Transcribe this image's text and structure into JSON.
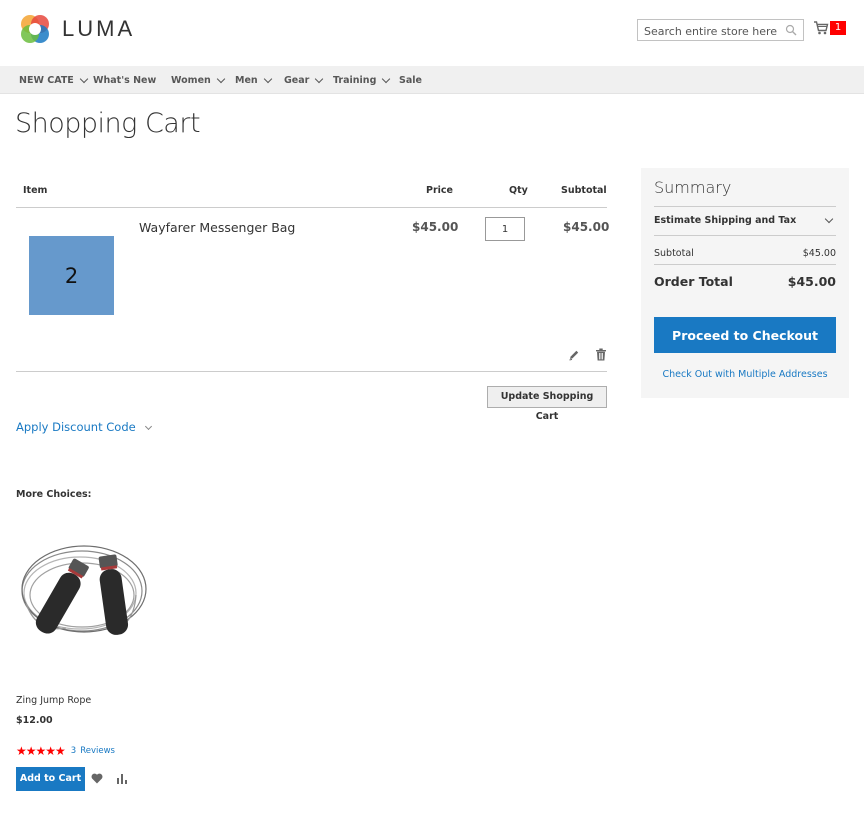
{
  "brand": {
    "name": "LUMA"
  },
  "search": {
    "placeholder": "Search entire store here..."
  },
  "minicart": {
    "count": "1"
  },
  "nav": {
    "items": [
      {
        "label": "NEW CATE",
        "has_dropdown": true
      },
      {
        "label": "What's New",
        "has_dropdown": false
      },
      {
        "label": "Women",
        "has_dropdown": true
      },
      {
        "label": "Men",
        "has_dropdown": true
      },
      {
        "label": "Gear",
        "has_dropdown": true
      },
      {
        "label": "Training",
        "has_dropdown": true
      },
      {
        "label": "Sale",
        "has_dropdown": false
      }
    ]
  },
  "page": {
    "title": "Shopping Cart"
  },
  "cart": {
    "headers": {
      "item": "Item",
      "price": "Price",
      "qty": "Qty",
      "subtotal": "Subtotal"
    },
    "items": [
      {
        "thumbnail_text": "2",
        "name": "Wayfarer Messenger Bag",
        "price": "$45.00",
        "qty": "1",
        "subtotal": "$45.00"
      }
    ],
    "update_label": "Update Shopping Cart",
    "discount_label": "Apply Discount Code"
  },
  "summary": {
    "title": "Summary",
    "estimate_label": "Estimate Shipping and Tax",
    "subtotal_label": "Subtotal",
    "subtotal_value": "$45.00",
    "total_label": "Order Total",
    "total_value": "$45.00",
    "checkout_label": "Proceed to Checkout",
    "multi_label": "Check Out with Multiple Addresses"
  },
  "crosssell": {
    "title": "More Choices:",
    "product": {
      "name": "Zing Jump Rope",
      "price": "$12.00",
      "rating_stars": 4.5,
      "review_count": "3",
      "reviews_label": "Reviews",
      "add_label": "Add to Cart"
    }
  },
  "colors": {
    "primary": "#1979c3",
    "cart_badge": "#ff0000",
    "thumb_bg": "#6699cc",
    "nav_bg": "#f0f0f0",
    "summary_bg": "#f5f5f5"
  }
}
